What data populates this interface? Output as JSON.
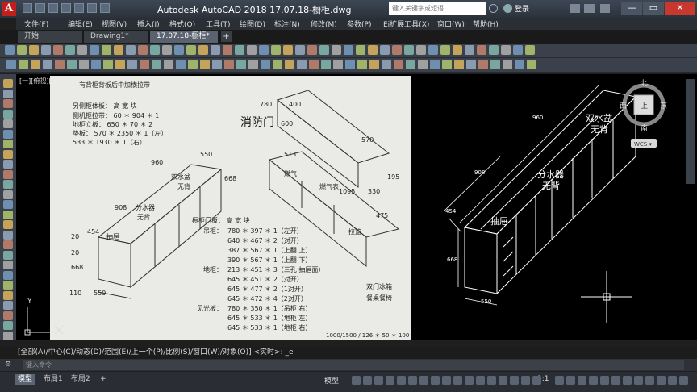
{
  "app": {
    "logo_letter": "A",
    "title": "Autodesk AutoCAD 2018      17.07.18-橱柜.dwg",
    "search_placeholder": "键入关键字或短语",
    "login": "登录",
    "window_controls": [
      "—",
      "▭",
      "✕"
    ]
  },
  "menu": [
    "文件(F)",
    "编辑(E)",
    "视图(V)",
    "插入(I)",
    "格式(O)",
    "工具(T)",
    "绘图(D)",
    "标注(N)",
    "修改(M)",
    "参数(P)",
    "Ei扩展工具(X)",
    "窗口(W)",
    "帮助(H)"
  ],
  "tabs": [
    {
      "label": "开始",
      "active": false
    },
    {
      "label": "Drawing1*",
      "active": false
    },
    {
      "label": "17.07.18-橱柜*",
      "active": true
    }
  ],
  "tab_add": "+",
  "viewport_label": "[一][俯视][二维线框]",
  "scan": {
    "header": "有背柜背板后中加横拉带",
    "side_board_title": "另侧柜体板：  高      宽     块",
    "side_rows": [
      "侧机柜拉带： 60 ＊ 904 ＊ 1",
      "地柜立板： 650 ＊  70 ＊ 2",
      "垫板： 570 ＊ 2350 ＊ 1（左）",
      "       533 ＊ 1930 ＊ 1（右）"
    ],
    "fire_door": "消防门",
    "door_title": "橱柜门板：  高     宽     块",
    "hanging_label": "吊柜：",
    "door_rows": [
      "780 ＊ 397 ＊ 1（左开）",
      "640 ＊ 467 ＊ 2（对开）",
      "387 ＊ 567 ＊ 1（上翻 上）",
      "390 ＊ 567 ＊ 1（上翻 下）",
      "213 ＊ 451 ＊ 3（三孔 抽屉面）",
      "645 ＊ 451 ＊ 2（对开）",
      "645 ＊ 477 ＊ 2（1对开）",
      "645 ＊ 472 ＊ 4（2对开）",
      "780 ＊ 350 ＊ 1（吊柜 右）",
      "645 ＊ 533 ＊ 1（地柜 左）",
      "645 ＊ 533 ＊ 1（地柜 右）"
    ],
    "floor_label": "地柜：",
    "light_label": "见光板：",
    "fridge": "双门冰箱",
    "dining": "餐桌餐椅",
    "labels": {
      "double_sink": "双水盆",
      "no_back": "无背",
      "sink": "分水器",
      "drawer": "抽屉",
      "gas_meter": "燃气表",
      "gas": "燃气",
      "pull_basket": "拉篮",
      "no_back2": "无背"
    },
    "dims": {
      "d550": "550",
      "d960": "960",
      "d668": "668",
      "d908": "908",
      "d454": "454",
      "d110": "110",
      "d20": "20",
      "d20b": "20",
      "d780": "780",
      "d400": "400",
      "d600": "600",
      "d570": "570",
      "d513": "513",
      "d330": "330",
      "d475": "475",
      "d195": "195",
      "d1095": "1095"
    },
    "footer": "1000/1500 / 126 ＊ 50 ＊ 100"
  },
  "cad": {
    "double_sink": "双水盆",
    "no_back_1": "无背",
    "sink": "分水器",
    "no_back_2": "无背",
    "drawer": "抽屉",
    "dim_960": "960",
    "dim_908": "908",
    "dim_454": "454",
    "dim_668": "668",
    "dim_550": "550"
  },
  "viewcube": {
    "north": "北",
    "south": "南",
    "east": "东",
    "west": "西",
    "face": "上",
    "wcs": "WCS ▾"
  },
  "ucs": {
    "y": "Y"
  },
  "command": {
    "history": "[全部(A)/中心(C)/动态(D)/范围(E)/上一个(P)/比例(S)/窗口(W)/对象(O)] <实时>: _e",
    "prompt": "键入命令"
  },
  "layouts": [
    "模型",
    "布局1",
    "布局2"
  ],
  "layout_add": "+",
  "status": {
    "model": "模型",
    "scale": "1:1"
  },
  "colors": {
    "accent": "#c0201c",
    "cad_bg": "#000000",
    "chrome": "#3b414a"
  }
}
